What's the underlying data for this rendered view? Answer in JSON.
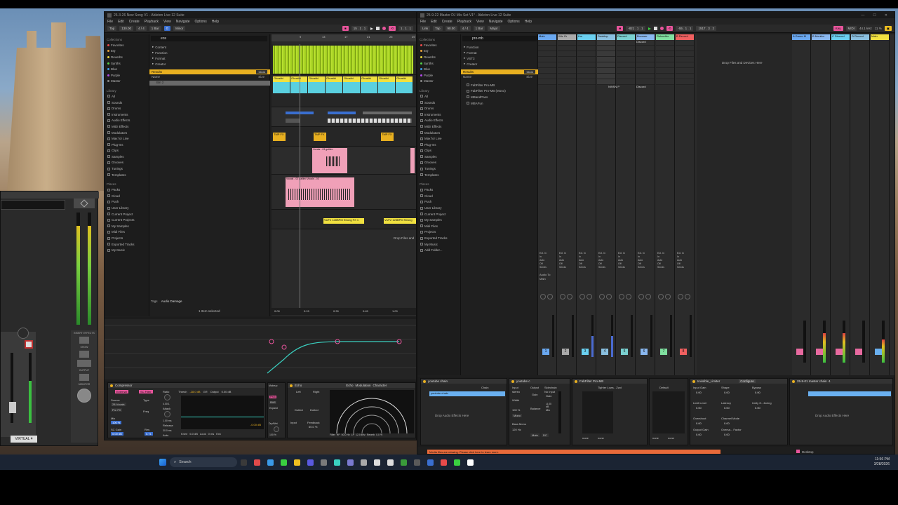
{
  "left_window": {
    "title": "26-3-26 New Song V1 - Ableton Live 12 Suite",
    "menu": [
      "File",
      "Edit",
      "Create",
      "Playback",
      "View",
      "Navigate",
      "Options",
      "Help"
    ],
    "transport": {
      "tap": "Tap",
      "bpm": "130.00",
      "sig": "4 / 4",
      "bar": "1 Bar",
      "key": "Minor",
      "pos": "15 . 1 . 1",
      "pos2": "1 . 1 . 1"
    },
    "search": "eos",
    "filters": [
      "Content",
      "Function",
      "Format",
      "Creator"
    ],
    "results_label": "Results",
    "clear_label": "Clear",
    "name_col": "Name",
    "size_col": "Size",
    "result_item": "Bin 2",
    "collections_header": "Collections",
    "collections": [
      {
        "label": "Favorites",
        "color": "#e84a4a"
      },
      {
        "label": "EQ",
        "color": "#e8a03a"
      },
      {
        "label": "Reverbs",
        "color": "#e8d53a"
      },
      {
        "label": "Synths",
        "color": "#52d04a"
      },
      {
        "label": "Blue",
        "color": "#3a9ae8"
      },
      {
        "label": "Purple",
        "color": "#b04ae8"
      },
      {
        "label": "Master",
        "color": "#888888"
      }
    ],
    "library_header": "Library",
    "library": [
      "All",
      "Sounds",
      "Drums",
      "Instruments",
      "Audio Effects",
      "MIDI Effects",
      "Modulators",
      "Max for Live",
      "Plug-Ins",
      "Clips",
      "Samples",
      "Grooves",
      "Tunings",
      "Templates"
    ],
    "places_header": "Places",
    "places": [
      "Packs",
      "Cloud",
      "Push",
      "User Library",
      "Current Project",
      "Current Projects",
      "My Samples",
      "Midi Files",
      "Projects",
      "Exported Tracks",
      "My Music"
    ],
    "tags_label": "Tags",
    "tags_value": "Audio Damage",
    "status": "1 Item selected",
    "clips": {
      "ghost": "Ghostbi",
      "vocals1": "Vocals - 03 galileo",
      "vocals2": "Vocals - 02 galileo Vocals - 03",
      "vuf": "VUF2 128BPM Strong FX 1",
      "vuf2": "VUF2 128BPM Strong",
      "fx": "TMP FX"
    },
    "timeline": [
      "0:00",
      "0:15",
      "0:30",
      "0:45",
      "1:00"
    ],
    "bars": [
      "9",
      "13",
      "17",
      "21",
      "25",
      "29"
    ],
    "drop_label": "Drop Files and",
    "devices": {
      "compressor": "Compressor",
      "external": "External",
      "sc_filter": "SC Filter",
      "ratio": "Ratio",
      "ratio_val": "4.00:1",
      "attack": "Attack",
      "attack_val": "1.00 ms",
      "release": "Release",
      "release_val": "30.0 ms",
      "thresh": "Thresh",
      "thresh_val": "-28.0 dB",
      "gr": "GR",
      "output": "Output",
      "out_val": "0.00 dB",
      "knee": "Knee",
      "knee_val": "6.0 dB",
      "look": "Look",
      "look_val": "0 ms",
      "env": "Env",
      "source": "Source",
      "source_val": "28-Vocals",
      "pre_fx": "Pre FX",
      "type": "Type",
      "freq": "Freq",
      "mix": "Mix",
      "mix_val": "100 %",
      "sc_gain": "SC Gain",
      "sc_gain_val": "0.00 dB",
      "res": "Res",
      "res_val": "0.71",
      "auto": "Auto",
      "makeup": "Makeup",
      "peak": "Peak",
      "rms": "RMS",
      "expand": "Expand",
      "dry_wet": "Dry/Wet",
      "dry_val": "100 %",
      "echo": "Echo",
      "echo_tab": "Echo",
      "modulation_tab": "Modulation",
      "character_tab": "Character",
      "left": "Left",
      "right": "Right",
      "dotted": "Dotted",
      "input": "Input",
      "feedback": "Feedback",
      "filter": "Filter",
      "filter_hp": "HP",
      "filter_val": "50.0 Hz",
      "filter_lp": "LP",
      "filter_lp_val": "12.0 kHz",
      "reverb": "Reverb",
      "reverb_val": "0.0 %",
      "stereo": "Stereo",
      "stereo_val": "100 %",
      "output2": "Output",
      "output2_val": "0.00 dB",
      "gain_val": "-0.00 dB",
      "sixty": "60.0 %"
    }
  },
  "right_window": {
    "title": "25-9-22 Master DJ Mix Set V1* - Ableton Live 12 Suite",
    "menu": [
      "File",
      "Edit",
      "Create",
      "Playback",
      "View",
      "Navigate",
      "Options",
      "Help"
    ],
    "transport": {
      "link": "Link",
      "tap": "Tap",
      "bpm": "90.00",
      "sig": "4 / 4",
      "bar": "1 Bar",
      "key": "Major",
      "pos": "-821 . 1 . 1",
      "pos2": "-55 . 1 . 1",
      "end": "1517 . 3 . 2",
      "cpu": "11 %",
      "sr": "44.1 kHz",
      "midi": "MIDI",
      "keylab": "Key"
    },
    "search": "pro-mb",
    "filters": [
      "Function",
      "Format",
      "VST3",
      "Creator"
    ],
    "results_label": "Results",
    "clear_label": "Clear",
    "name_col": "Name",
    "size_col": "Size",
    "results": [
      "FabFilter Pro-MB",
      "FabFilter Pro-MB (Mono)",
      "MBandPass",
      "MBAFun"
    ],
    "collections_header": "Collections",
    "collections": [
      {
        "label": "Favorites",
        "color": "#e84a4a"
      },
      {
        "label": "EQ",
        "color": "#e8a03a"
      },
      {
        "label": "Reverbs",
        "color": "#e8d53a"
      },
      {
        "label": "Synths",
        "color": "#52d04a"
      },
      {
        "label": "Blue",
        "color": "#3a9ae8"
      },
      {
        "label": "Purple",
        "color": "#b04ae8"
      },
      {
        "label": "Master",
        "color": "#888888"
      }
    ],
    "library_header": "Library",
    "library": [
      "All",
      "Sounds",
      "Drums",
      "Instruments",
      "Audio Effects",
      "MIDI Effects",
      "Modulators",
      "Max for Live",
      "Plug-Ins",
      "Clips",
      "Samples",
      "Grooves",
      "Tunings",
      "Templates"
    ],
    "places_header": "Places",
    "places": [
      "Packs",
      "Cloud",
      "Push",
      "User Library",
      "Current Project",
      "My Samples",
      "Midi Files",
      "Projects",
      "Exported Tracks",
      "My Music",
      "Add Folder..."
    ],
    "mixer_tracks": [
      {
        "name": "Main",
        "color": "#6aa8f0",
        "num": "1"
      },
      {
        "name": "Wiz Gr",
        "color": "#aaaaaa",
        "num": "2"
      },
      {
        "name": "Hm",
        "color": "#6ad0f0",
        "num": "3"
      },
      {
        "name": "Desktop",
        "color": "#8ac0e0",
        "num": "4"
      },
      {
        "name": "Discord",
        "color": "#7ad0d0",
        "num": "5"
      },
      {
        "name": "Browser",
        "color": "#8ab8f0",
        "num": "6"
      },
      {
        "name": "Rekordbo",
        "color": "#80e0a0",
        "num": "7"
      },
      {
        "name": "B Record",
        "color": "#f06060",
        "num": "8"
      }
    ],
    "return_tracks": [
      {
        "name": "A Game M",
        "color": "#6aa8f0"
      },
      {
        "name": "B Monitor",
        "color": "#8ab8f0"
      },
      {
        "name": "C Discord",
        "color": "#6ad0f0"
      },
      {
        "name": "D Record",
        "color": "#8ac0e0"
      },
      {
        "name": "Main",
        "color": "#f0e040"
      }
    ],
    "clip_labels": {
      "discord": "Discord",
      "nwsn": "NWSN P",
      "discord2": "Discord"
    },
    "drop_label": "Drop Files and Devices Here",
    "audio_to": "Audio To",
    "main": "Main",
    "sends": "Sends",
    "ext_in": "Ext. In",
    "monitor": "Monitor",
    "in": "In",
    "auto": "Auto",
    "off": "Off",
    "devices": {
      "youtube1": "youtube chain",
      "youtube2": "youtube c",
      "chain": "Chain",
      "input": "Input",
      "output": "Output",
      "sidechain": "Sidechain",
      "no_input": "No Input",
      "gain": "Gain",
      "width": "Width",
      "balance": "Balance",
      "mono": "Mono",
      "bass_mono": "Bass Mono",
      "bass_val": "120 Hz",
      "mute": "Mute",
      "dc": "DC",
      "stereo": "stereo",
      "drop_audio": "Drop Audio Effects Here",
      "pro_mb": "FabFilter Pro-MB",
      "tighter": "Tighter Lows - Zwd",
      "default": "Default",
      "none": "none",
      "invisible": "Invisible_Limiter",
      "configure": "Configure",
      "input_gain": "Input Gain",
      "shape": "Shape",
      "bypass": "Bypass",
      "limit_level": "Limit Level",
      "latency": "Latency",
      "unity": "Unity G...ltoring",
      "overshoot": "Overshoot",
      "channel_mode": "Channel Mode",
      "output_gain": "Output Gain",
      "oversample": "Oversa... Factor",
      "master_chain": "25-9-01 master chain -1",
      "zero": "0.00",
      "one": "1.00",
      "drop_audio2": "Drop Audio Effects Here",
      "width_val": "100 %",
      "gain_db": "-6.00 dB"
    },
    "status_msg": "Media files are missing. Please click here to learn more.",
    "status_right": "Desktop"
  },
  "uad": {
    "label": "VIRTUAL 4",
    "insert_effects": "INSERT EFFECTS",
    "show": "SHOW",
    "output": "OUTPUT",
    "monitor": "MONITOR"
  },
  "taskbar": {
    "search": "Search",
    "time": "11:56 PM",
    "date": "3/28/2026"
  }
}
